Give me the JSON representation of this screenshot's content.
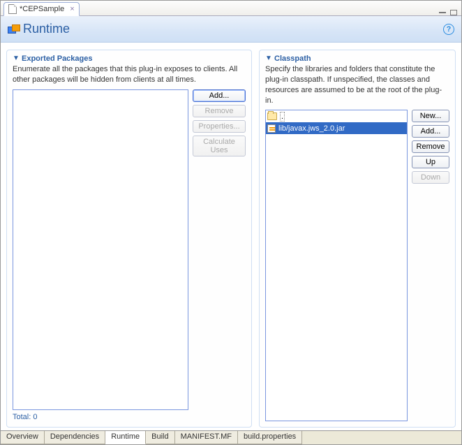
{
  "tab": {
    "title": "*CEPSample"
  },
  "page": {
    "title": "Runtime"
  },
  "exported": {
    "header": "Exported Packages",
    "desc": "Enumerate all the packages that this plug-in exposes to clients. All other packages will be hidden from clients at all times.",
    "total_label": "Total: 0",
    "buttons": {
      "add": "Add...",
      "remove": "Remove",
      "properties": "Properties...",
      "calc": "Calculate Uses"
    }
  },
  "classpath": {
    "header": "Classpath",
    "desc": "Specify the libraries and folders that constitute the plug-in classpath.  If unspecified, the classes and resources are assumed to be at the root of the plug-in.",
    "items": [
      {
        "icon": "folder",
        "label": ".",
        "selected": false,
        "root": true
      },
      {
        "icon": "jar",
        "label": "lib/javax.jws_2.0.jar",
        "selected": true
      }
    ],
    "buttons": {
      "new": "New...",
      "add": "Add...",
      "remove": "Remove",
      "up": "Up",
      "down": "Down"
    }
  },
  "bottom_tabs": [
    "Overview",
    "Dependencies",
    "Runtime",
    "Build",
    "MANIFEST.MF",
    "build.properties"
  ],
  "bottom_active": "Runtime"
}
